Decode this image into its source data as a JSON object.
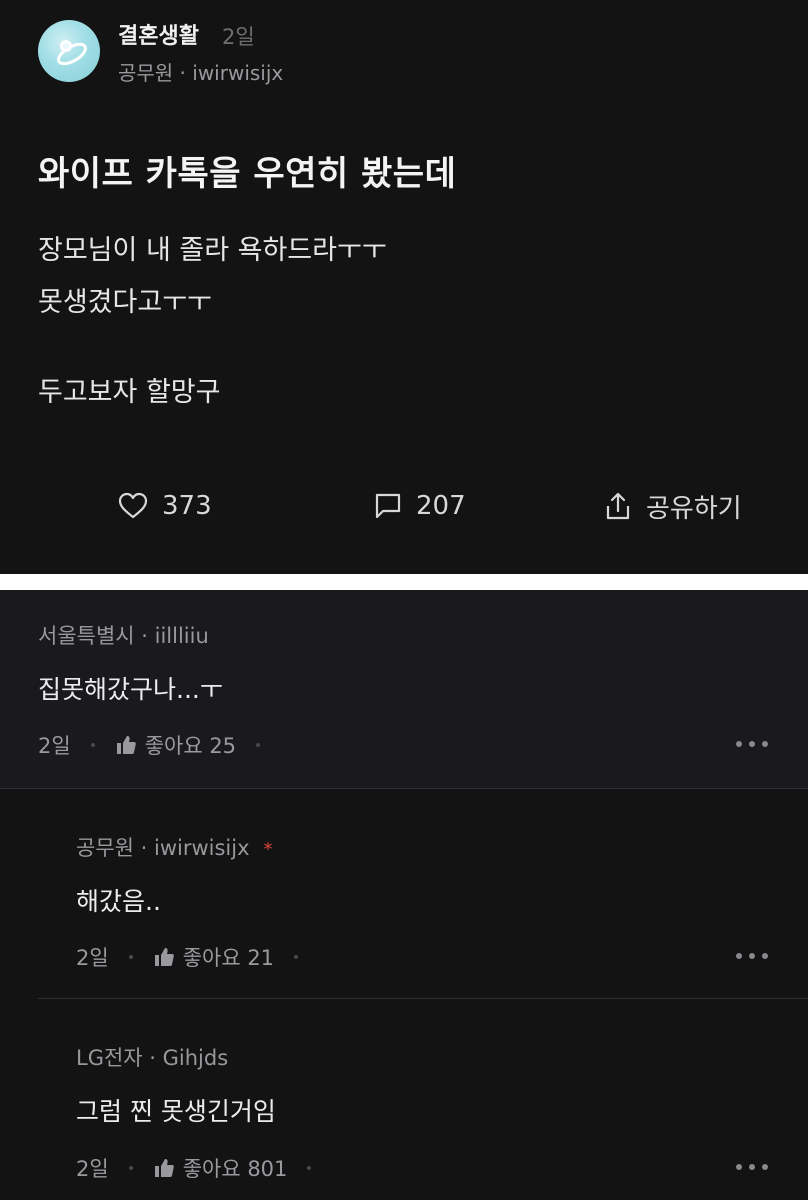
{
  "post": {
    "board": "결혼생활",
    "time": "2일",
    "author": "공무원 · iwirwisijx",
    "title": "와이프 카톡을 우연히 봤는데",
    "body": [
      "장모님이 내 졸라 욕하드라ㅜㅜ",
      "못생겼다고ㅜㅜ",
      "두고보자 할망구"
    ],
    "likes": "373",
    "comments": "207",
    "share": "공유하기"
  },
  "comments": [
    {
      "meta": "서울특별시 · iillliiu",
      "text": "집못해갔구나...ㅜ",
      "time": "2일",
      "like_label": "좋아요 25"
    },
    {
      "meta": "공무원 · iwirwisijx",
      "badge": "*",
      "text": "해갔음..",
      "time": "2일",
      "like_label": "좋아요 21"
    },
    {
      "meta": "LG전자 · Gihjds",
      "text": "그럼 찐 못생긴거임",
      "time": "2일",
      "like_label": "좋아요 801"
    }
  ],
  "icons": {
    "avatar": "ring-avatar",
    "like": "heart-icon",
    "comment": "speech-bubble-icon",
    "share": "share-icon",
    "thumb": "thumbs-up-icon",
    "more": "more-dots-icon"
  },
  "colors": {
    "background": "#131314",
    "author_badge": "#e0453a"
  }
}
